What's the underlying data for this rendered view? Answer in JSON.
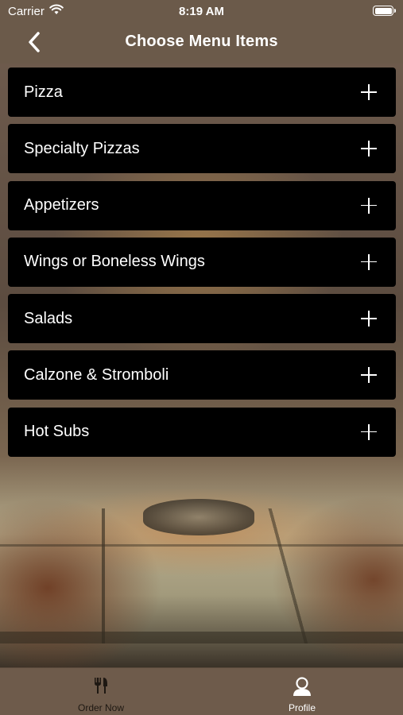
{
  "status_bar": {
    "carrier": "Carrier",
    "time": "8:19 AM"
  },
  "nav": {
    "title": "Choose Menu Items",
    "back_icon": "chevron-left-icon"
  },
  "menu": {
    "items": [
      {
        "label": "Pizza"
      },
      {
        "label": "Specialty Pizzas"
      },
      {
        "label": "Appetizers"
      },
      {
        "label": "Wings or Boneless Wings"
      },
      {
        "label": "Salads"
      },
      {
        "label": "Calzone & Stromboli"
      },
      {
        "label": "Hot Subs"
      }
    ],
    "expand_icon": "plus-icon"
  },
  "tabs": [
    {
      "label": "Order Now",
      "icon": "utensils-icon",
      "selected": false
    },
    {
      "label": "Profile",
      "icon": "person-icon",
      "selected": true
    }
  ],
  "colors": {
    "bar_background": "#6e5b4b",
    "item_background": "#000000",
    "text": "#ffffff"
  }
}
